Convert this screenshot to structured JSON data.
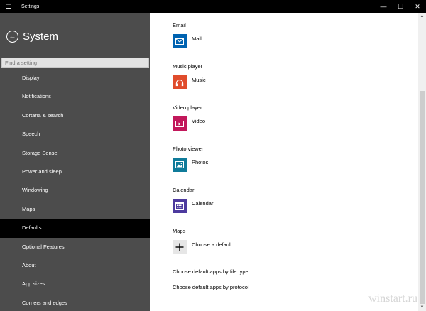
{
  "window": {
    "title": "Settings"
  },
  "sidebar": {
    "title": "System",
    "search_placeholder": "Find a setting",
    "items": [
      {
        "label": "Display",
        "active": false
      },
      {
        "label": "Notifications",
        "active": false
      },
      {
        "label": "Cortana & search",
        "active": false
      },
      {
        "label": "Speech",
        "active": false
      },
      {
        "label": "Storage Sense",
        "active": false
      },
      {
        "label": "Power and sleep",
        "active": false
      },
      {
        "label": "Windowing",
        "active": false
      },
      {
        "label": "Maps",
        "active": false
      },
      {
        "label": "Defaults",
        "active": true
      },
      {
        "label": "Optional Features",
        "active": false
      },
      {
        "label": "About",
        "active": false
      },
      {
        "label": "App sizes",
        "active": false
      },
      {
        "label": "Corners and edges",
        "active": false
      }
    ]
  },
  "defaults": {
    "email": {
      "label": "Email",
      "app": "Mail",
      "icon": "mail-icon",
      "color": "#0063b1"
    },
    "music": {
      "label": "Music player",
      "app": "Music",
      "icon": "headphones-icon",
      "color": "#e04c2c"
    },
    "video": {
      "label": "Video player",
      "app": "Video",
      "icon": "video-icon",
      "color": "#c2185b"
    },
    "photo": {
      "label": "Photo viewer",
      "app": "Photos",
      "icon": "photos-icon",
      "color": "#0f7b9a"
    },
    "calendar": {
      "label": "Calendar",
      "app": "Calendar",
      "icon": "calendar-icon",
      "color": "#4d3a9e"
    },
    "maps": {
      "label": "Maps",
      "app": "Choose a default",
      "icon": "plus-icon",
      "color": "#e6e6e6"
    }
  },
  "links": {
    "by_file_type": "Choose default apps by file type",
    "by_protocol": "Choose default apps by protocol"
  },
  "watermark": "winstart.ru"
}
